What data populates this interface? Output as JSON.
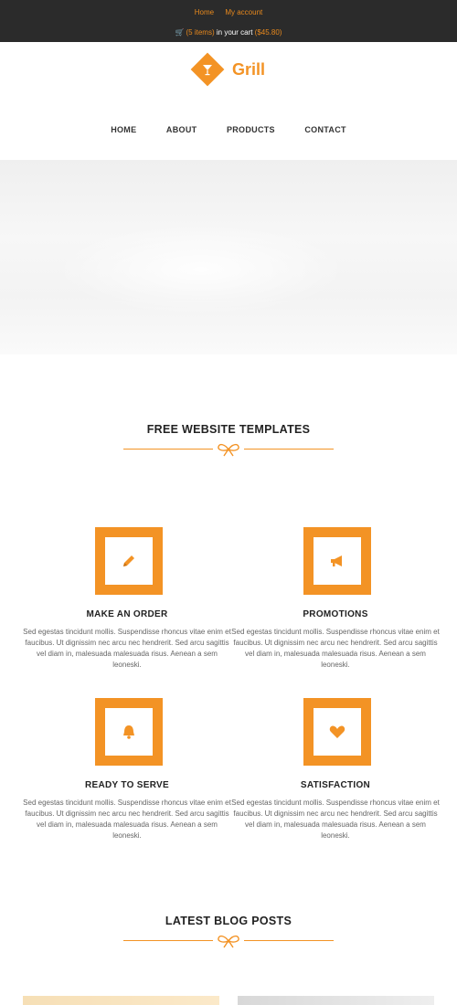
{
  "topbar": {
    "links": [
      "Home",
      "My account"
    ],
    "cart_count": "(5 items)",
    "cart_middle": " in your cart ",
    "cart_total": "($45.80)"
  },
  "logo": {
    "text": "Grill"
  },
  "nav": {
    "items": [
      "HOME",
      "ABOUT",
      "PRODUCTS",
      "CONTACT"
    ]
  },
  "sections": {
    "templates_title": "FREE WEBSITE TEMPLATES",
    "blog_title": "LATEST BLOG POSTS"
  },
  "features": [
    {
      "icon": "pencil-icon",
      "title": "MAKE AN ORDER",
      "desc": "Sed egestas tincidunt mollis. Suspendisse rhoncus vitae enim et faucibus. Ut dignissim nec arcu nec hendrerit. Sed arcu sagittis vel diam in, malesuada malesuada risus. Aenean a sem leoneski."
    },
    {
      "icon": "megaphone-icon",
      "title": "PROMOTIONS",
      "desc": "Sed egestas tincidunt mollis. Suspendisse rhoncus vitae enim et faucibus. Ut dignissim nec arcu nec hendrerit. Sed arcu sagittis vel diam in, malesuada malesuada risus. Aenean a sem leoneski."
    },
    {
      "icon": "bell-icon",
      "title": "READY TO SERVE",
      "desc": "Sed egestas tincidunt mollis. Suspendisse rhoncus vitae enim et faucibus. Ut dignissim nec arcu nec hendrerit. Sed arcu sagittis vel diam in, malesuada malesuada risus. Aenean a sem leoneski."
    },
    {
      "icon": "heart-icon",
      "title": "SATISFACTION",
      "desc": "Sed egestas tincidunt mollis. Suspendisse rhoncus vitae enim et faucibus. Ut dignissim nec arcu nec hendrerit. Sed arcu sagittis vel diam in, malesuada malesuada risus. Aenean a sem leoneski."
    }
  ],
  "colors": {
    "accent": "#f39325",
    "topbar": "#2b2b2b"
  }
}
